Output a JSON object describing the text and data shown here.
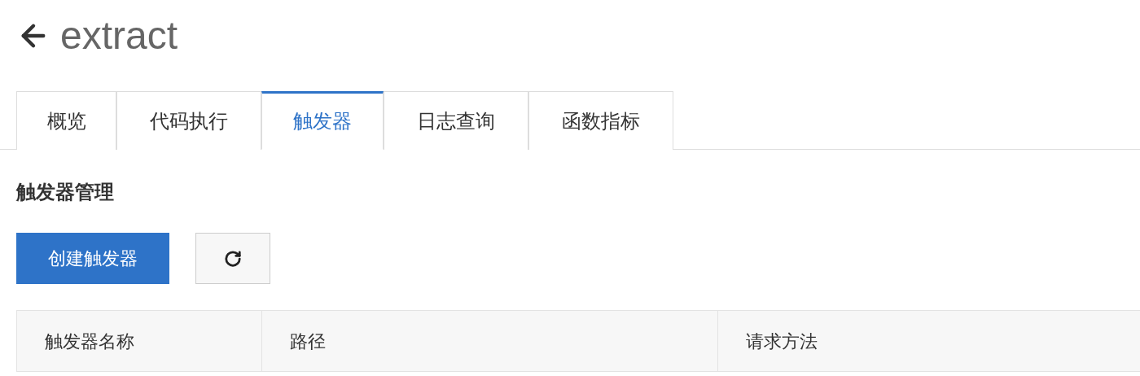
{
  "header": {
    "title": "extract"
  },
  "tabs": [
    {
      "label": "概览",
      "selected": false
    },
    {
      "label": "代码执行",
      "selected": false
    },
    {
      "label": "触发器",
      "selected": true
    },
    {
      "label": "日志查询",
      "selected": false
    },
    {
      "label": "函数指标",
      "selected": false
    }
  ],
  "section_title": "触发器管理",
  "toolbar": {
    "create_button": "创建触发器"
  },
  "table": {
    "columns": [
      "触发器名称",
      "路径",
      "请求方法"
    ]
  }
}
